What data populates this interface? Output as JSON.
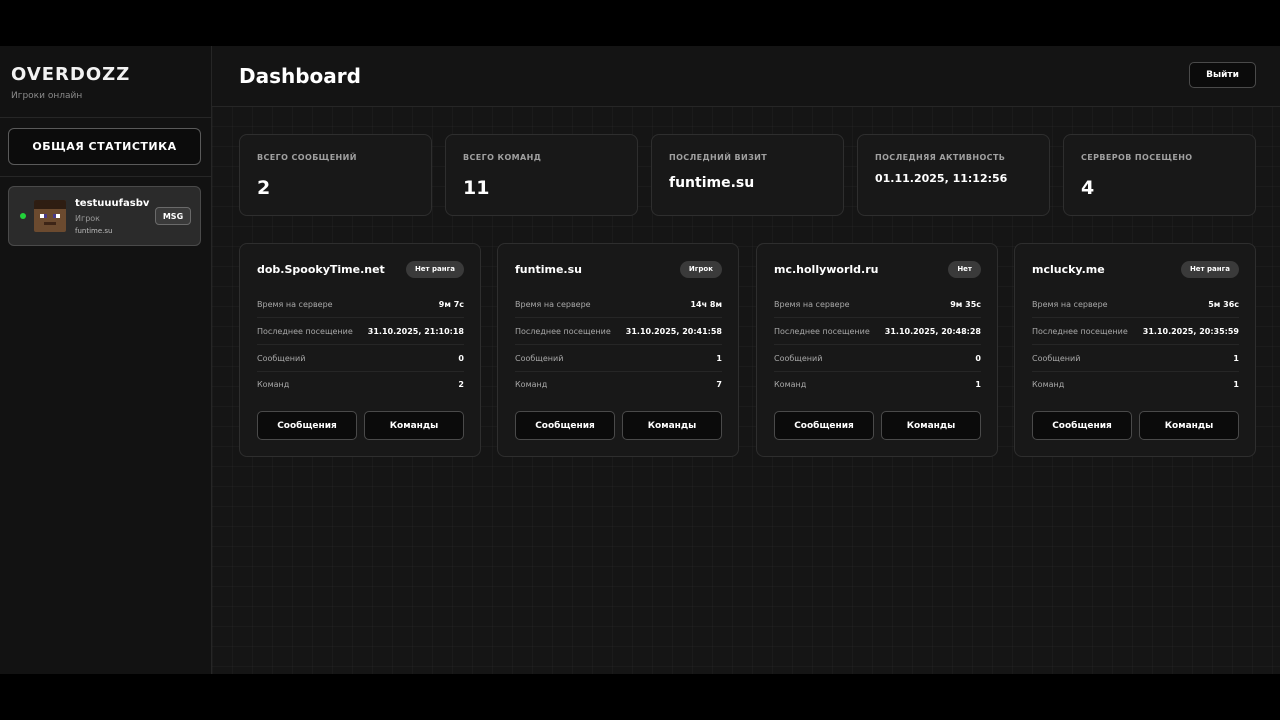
{
  "sidebar": {
    "brand": "OVERDOZZ",
    "subtitle": "Игроки онлайн",
    "stats_button": "ОБЩАЯ СТАТИСТИКА",
    "player": {
      "name": "testuuufasbv",
      "role": "Игрок",
      "server": "funtime.su",
      "msg_button": "MSG",
      "status_color": "#22d13a"
    }
  },
  "header": {
    "title": "Dashboard",
    "logout": "Выйти"
  },
  "stats": [
    {
      "label": "ВСЕГО СООБЩЕНИЙ",
      "value": "2"
    },
    {
      "label": "ВСЕГО КОМАНД",
      "value": "11"
    },
    {
      "label": "ПОСЛЕДНИЙ ВИЗИТ",
      "value": "funtime.su"
    },
    {
      "label": "ПОСЛЕДНЯЯ АКТИВНОСТЬ",
      "value": "01.11.2025, 11:12:56"
    },
    {
      "label": "СЕРВЕРОВ ПОСЕЩЕНО",
      "value": "4"
    }
  ],
  "row_labels": {
    "time": "Время на сервере",
    "last_visit": "Последнее посещение",
    "messages": "Сообщений",
    "commands": "Команд"
  },
  "button_labels": {
    "messages": "Сообщения",
    "commands": "Команды"
  },
  "servers": [
    {
      "name": "dob.SpookyTime.net",
      "badge": "Нет ранга",
      "time": "9м 7с",
      "last_visit": "31.10.2025, 21:10:18",
      "messages": "0",
      "commands": "2"
    },
    {
      "name": "funtime.su",
      "badge": "Игрок",
      "time": "14ч 8м",
      "last_visit": "31.10.2025, 20:41:58",
      "messages": "1",
      "commands": "7"
    },
    {
      "name": "mc.hollyworld.ru",
      "badge": "Нет",
      "time": "9м 35с",
      "last_visit": "31.10.2025, 20:48:28",
      "messages": "0",
      "commands": "1"
    },
    {
      "name": "mclucky.me",
      "badge": "Нет ранга",
      "time": "5м 36с",
      "last_visit": "31.10.2025, 20:35:59",
      "messages": "1",
      "commands": "1"
    }
  ]
}
